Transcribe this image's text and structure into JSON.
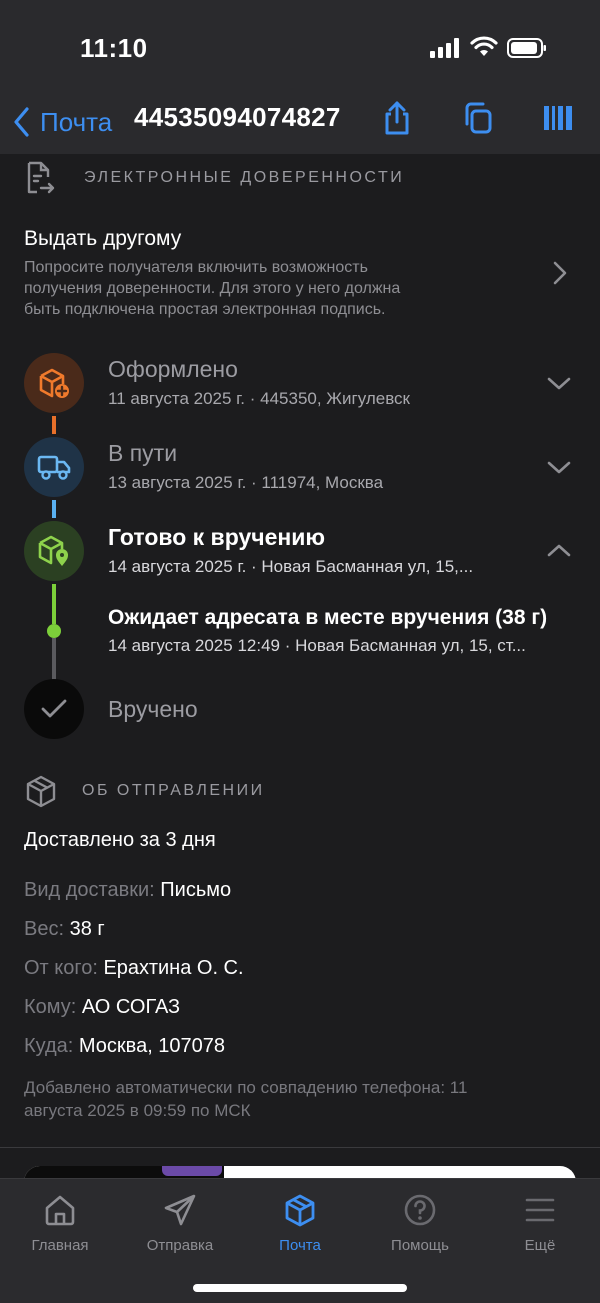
{
  "status_bar": {
    "time": "11:10"
  },
  "nav": {
    "back_label": "Почта",
    "title": "44535094074827"
  },
  "proxy_section": {
    "header": "ЭЛЕКТРОННЫЕ ДОВЕРЕННОСТИ",
    "row_title": "Выдать другому",
    "row_desc_lines": [
      "Попросите получателя включить возможность",
      "получения доверенности. Для этого у него должна",
      "быть подключена простая электронная подпись."
    ]
  },
  "timeline": [
    {
      "title": "Оформлено",
      "subtitle": "11 августа 2025 г. · 445350, Жигулевск",
      "color": "#e8702a"
    },
    {
      "title": "В пути",
      "subtitle": "13 августа 2025 г. · 111974, Москва",
      "color": "#5ab0f0"
    },
    {
      "title": "Готово к вручению",
      "subtitle": "14 августа 2025 г. · Новая Басманная ул, 15,...",
      "color": "#7ccf3a"
    },
    {
      "title": "Ожидает адресата в месте вручения (38 г)",
      "subtitle": "14 августа 2025 12:49 · Новая Басманная ул, 15, ст..."
    },
    {
      "title": "Вручено"
    }
  ],
  "about_section": {
    "header": "ОБ ОТПРАВЛЕНИИ",
    "delivered": "Доставлено за 3 дня",
    "fields": [
      {
        "key": "Вид доставки:",
        "value": "Письмо"
      },
      {
        "key": "Вес:",
        "value": "38 г"
      },
      {
        "key": "От кого:",
        "value": "Ерахтина О. С."
      },
      {
        "key": "Кому:",
        "value": "АО СОГАЗ"
      },
      {
        "key": "Куда:",
        "value": "Москва, 107078"
      }
    ],
    "note_lines": [
      "Добавлено автоматически по совпадению телефона: 11",
      "августа 2025 в 09:59 по МСК"
    ]
  },
  "tabs": [
    {
      "label": "Главная",
      "icon": "home-icon"
    },
    {
      "label": "Отправка",
      "icon": "send-icon"
    },
    {
      "label": "Почта",
      "icon": "parcel-icon",
      "active": true
    },
    {
      "label": "Помощь",
      "icon": "help-icon"
    },
    {
      "label": "Ещё",
      "icon": "menu-icon"
    }
  ],
  "colors": {
    "accent": "#3d8ef0",
    "background": "#1c1c1e",
    "bar": "#2a2a2d"
  }
}
